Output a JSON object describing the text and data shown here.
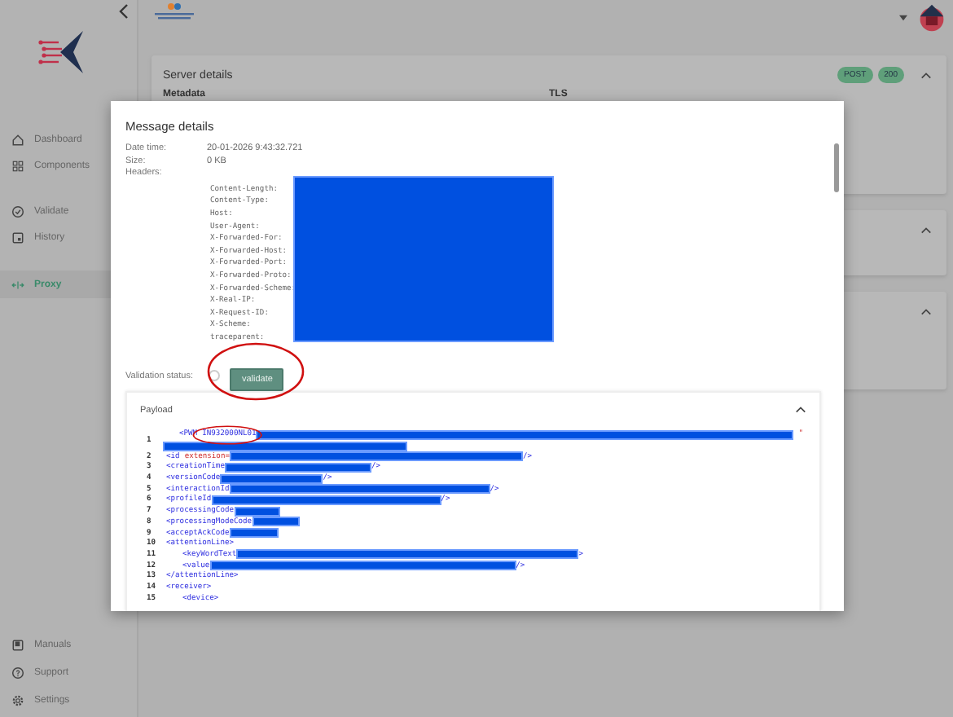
{
  "sidebar": {
    "items": [
      {
        "label": "Dashboard",
        "selected": false
      },
      {
        "label": "Components",
        "selected": false
      },
      {
        "label": "Validate",
        "selected": false
      },
      {
        "label": "History",
        "selected": false
      },
      {
        "label": "Proxy",
        "selected": true
      }
    ],
    "bottom_items": [
      {
        "label": "Manuals",
        "selected": false
      },
      {
        "label": "Support",
        "selected": false
      },
      {
        "label": "Settings",
        "selected": false
      }
    ]
  },
  "server_card": {
    "title": "Server details",
    "badges": [
      "POST",
      "200"
    ],
    "sections": [
      "Metadata",
      "TLS"
    ]
  },
  "modal": {
    "title": "Message details",
    "fields": [
      {
        "label": "Date time:",
        "value": "20-01-2026 9:43:32.721"
      },
      {
        "label": "Size:",
        "value": "0 KB"
      }
    ],
    "headers_label": "Headers:",
    "headers": [
      "Content-Length:",
      "Content-Type:",
      "Host:",
      "User-Agent:",
      "X-Forwarded-For:",
      "X-Forwarded-Host:",
      "X-Forwarded-Port:",
      "X-Forwarded-Proto:",
      "X-Forwarded-Scheme:",
      "X-Real-IP:",
      "X-Request-ID:",
      "X-Scheme:",
      "traceparent:"
    ],
    "validation": {
      "label": "Validation status:",
      "button": "validate"
    },
    "payload": {
      "title": "Payload",
      "expanded": true,
      "lines": [
        {
          "number": "1",
          "tag": "<PWM",
          "value": "IN932000NL01",
          "redacted": true,
          "end": "\"",
          "wrapped": true
        },
        {
          "number": "2",
          "tag": "<id",
          "attribute": "extension=",
          "redacted": true,
          "end": "/>"
        },
        {
          "number": "3",
          "tag": "<creationTime",
          "redacted": true,
          "end": "/>"
        },
        {
          "number": "4",
          "tag": "<versionCode",
          "redacted": true,
          "end": "/>"
        },
        {
          "number": "5",
          "tag": "<interactionId",
          "redacted": true,
          "end": "/>"
        },
        {
          "number": "6",
          "tag": "<profileId",
          "redacted": true,
          "end": "/>"
        },
        {
          "number": "7",
          "tag": "<processingCode",
          "redacted": true
        },
        {
          "number": "8",
          "tag": "<processingModeCode",
          "redacted": true
        },
        {
          "number": "9",
          "tag": "<acceptAckCode",
          "redacted": true
        },
        {
          "number": "10",
          "tag": "<attentionLine>",
          "children": [
            {
              "number": "11",
              "tag": "<keyWordText",
              "redacted": true,
              "end": ">"
            },
            {
              "number": "12",
              "tag": "<value",
              "redacted": true,
              "end": "/>"
            }
          ]
        },
        {
          "number": "13",
          "tag": "</attentionLine>"
        },
        {
          "number": "14",
          "tag": "<receiver>",
          "children": [
            {
              "number": "15",
              "tag": "<device>"
            }
          ]
        }
      ]
    }
  }
}
